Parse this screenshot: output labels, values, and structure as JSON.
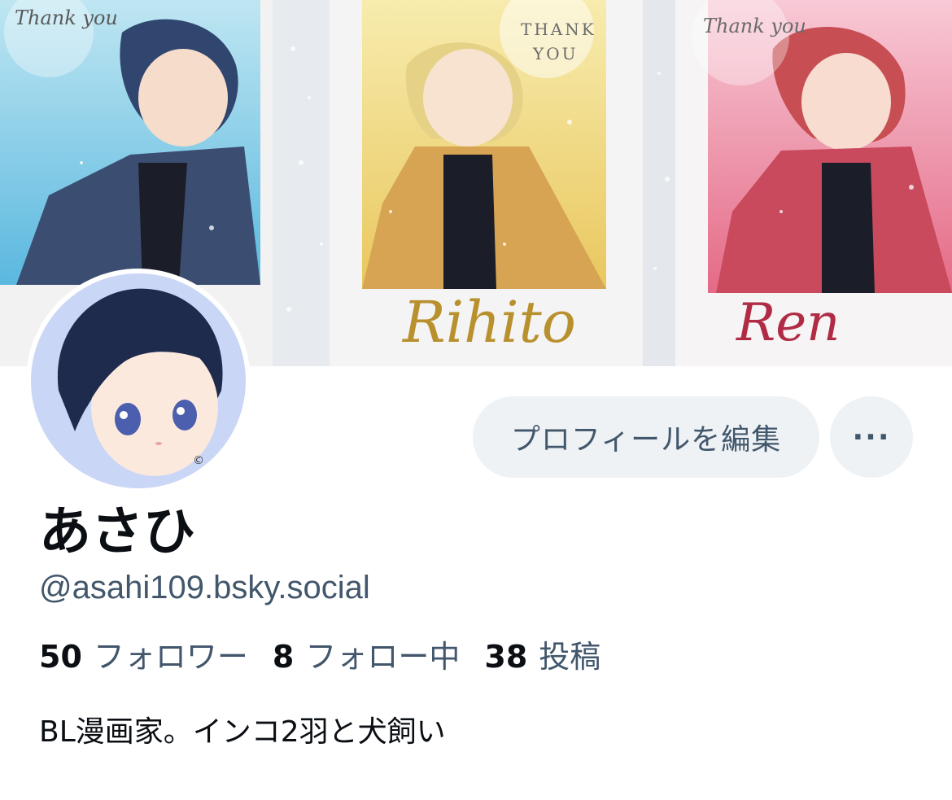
{
  "profile": {
    "display_name": "あさひ",
    "handle": "@asahi109.bsky.social",
    "bio": "BL漫画家。インコ2羽と犬飼い"
  },
  "actions": {
    "edit_profile_label": "プロフィールを編集",
    "more_label": "···"
  },
  "stats": {
    "followers_count": "50",
    "followers_label": "フォロワー",
    "following_count": "8",
    "following_label": "フォロー中",
    "posts_count": "38",
    "posts_label": "投稿"
  },
  "banner": {
    "card1_stamp": "Thank you",
    "card2_stamp_line1": "THANK",
    "card2_stamp_line2": "YOU",
    "card2_signature": "Rihito",
    "card3_stamp": "Thank you",
    "card3_signature": "Ren"
  },
  "colors": {
    "text_primary": "#0b0f14",
    "text_secondary": "#42576c",
    "button_bg": "#eef2f5"
  }
}
